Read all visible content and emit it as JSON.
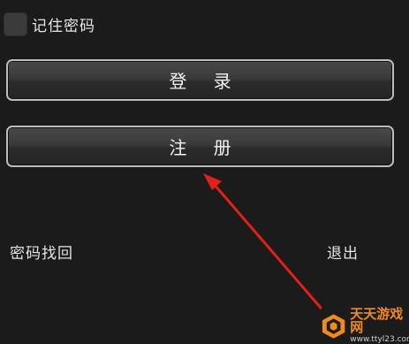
{
  "remember": {
    "label": "记住密码",
    "checked": false
  },
  "buttons": {
    "login_label": "登 录",
    "register_label": "注 册"
  },
  "links": {
    "recover_password": "密码找回",
    "exit": "退出"
  },
  "annotation": {
    "arrow_color": "#e0201a"
  },
  "watermark": {
    "title": "天天游戏网",
    "url": "www.ttyl23.com",
    "accent_color": "#f08a1c"
  }
}
